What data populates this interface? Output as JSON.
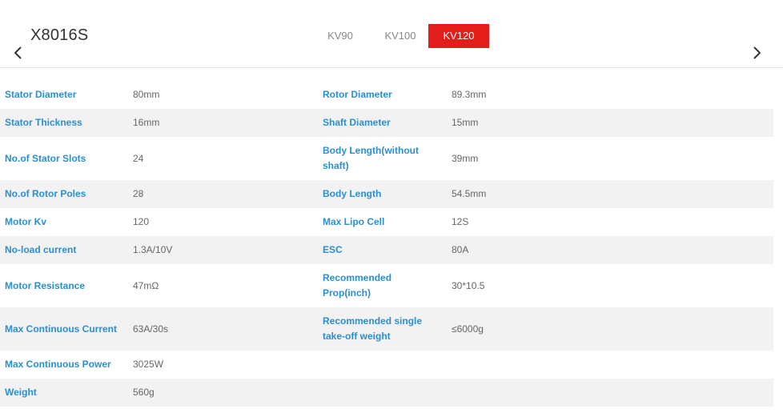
{
  "header": {
    "model_title": "X8016S",
    "tabs": [
      {
        "label": "KV90",
        "active": false
      },
      {
        "label": "KV100",
        "active": false
      },
      {
        "label": "KV120",
        "active": true
      }
    ],
    "active_tab_color": "#e31d1a",
    "prev_icon": "chevron-left-icon",
    "next_icon": "chevron-right-icon"
  },
  "specs": {
    "label_color": "#2a8fd1",
    "rows": [
      {
        "left_label": "Stator Diameter",
        "left_value": "80mm",
        "right_label": "Rotor Diameter",
        "right_value": "89.3mm"
      },
      {
        "left_label": "Stator Thickness",
        "left_value": "16mm",
        "right_label": "Shaft Diameter",
        "right_value": "15mm"
      },
      {
        "left_label": "No.of Stator Slots",
        "left_value": "24",
        "right_label": "Body Length(without shaft)",
        "right_value": "39mm"
      },
      {
        "left_label": "No.of Rotor Poles",
        "left_value": "28",
        "right_label": "Body Length",
        "right_value": "54.5mm"
      },
      {
        "left_label": "Motor Kv",
        "left_value": "120",
        "right_label": "Max Lipo Cell",
        "right_value": "12S"
      },
      {
        "left_label": "No-load current",
        "left_value": "1.3A/10V",
        "right_label": "ESC",
        "right_value": "80A"
      },
      {
        "left_label": "Motor Resistance",
        "left_value": "47mΩ",
        "right_label": "Recommended Prop(inch)",
        "right_value": "30*10.5"
      },
      {
        "left_label": "Max Continuous Current",
        "left_value": "63A/30s",
        "right_label": "Recommended single take-off weight",
        "right_value": "≤6000g"
      },
      {
        "left_label": "Max Continuous Power",
        "left_value": "3025W",
        "right_label": "",
        "right_value": ""
      },
      {
        "left_label": "Weight",
        "left_value": "560g",
        "right_label": "",
        "right_value": ""
      }
    ]
  }
}
